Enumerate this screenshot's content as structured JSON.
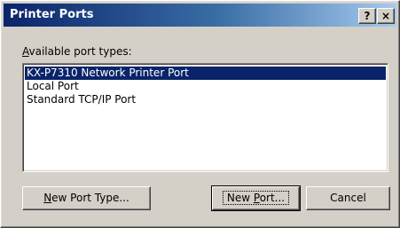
{
  "window": {
    "title": "Printer Ports",
    "help_button": "?",
    "close_button": "×"
  },
  "port_list": {
    "label_mnemonic": "A",
    "label_rest": "vailable port types:",
    "items": [
      {
        "label": "KX-P7310 Network Printer Port",
        "selected": true
      },
      {
        "label": "Local Port",
        "selected": false
      },
      {
        "label": "Standard TCP/IP Port",
        "selected": false
      }
    ]
  },
  "buttons": {
    "new_port_type": {
      "mnemonic": "N",
      "rest": "ew Port Type..."
    },
    "new_port": {
      "before": "New ",
      "mnemonic": "P",
      "rest": "ort..."
    },
    "cancel": "Cancel"
  },
  "colors": {
    "selection": "#0a246a",
    "face": "#d4d0c8"
  }
}
